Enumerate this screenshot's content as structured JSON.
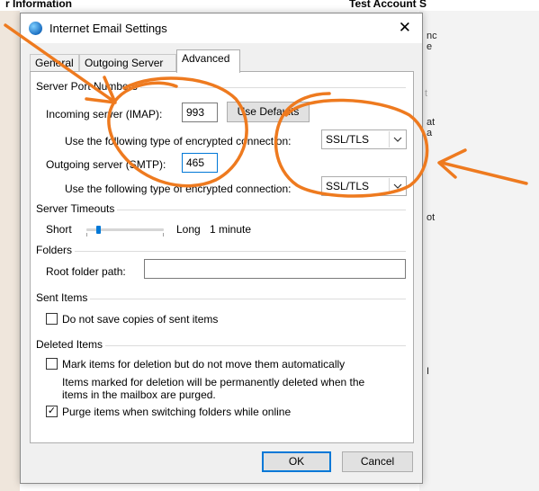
{
  "background": {
    "left_title": "r Information",
    "right_title": "Test Account S",
    "right_fragments": [
      "nc",
      "e",
      "t",
      "at",
      "a",
      "ot",
      "I"
    ]
  },
  "dialog": {
    "title": "Internet Email Settings",
    "close_glyph": "✕",
    "tabs": [
      "General",
      "Outgoing Server",
      "Advanced"
    ],
    "active_tab": "Advanced"
  },
  "server_ports": {
    "group_label": "Server Port Numbers",
    "incoming_label": "Incoming server (IMAP):",
    "incoming_value": "993",
    "use_defaults_label": "Use Defaults",
    "incoming_encryption_label": "Use the following type of encrypted connection:",
    "incoming_encryption_value": "SSL/TLS",
    "outgoing_label": "Outgoing server (SMTP):",
    "outgoing_value": "465",
    "outgoing_encryption_label": "Use the following type of encrypted connection:",
    "outgoing_encryption_value": "SSL/TLS"
  },
  "timeouts": {
    "group_label": "Server Timeouts",
    "short_label": "Short",
    "long_label": "Long",
    "value_label": "1 minute",
    "slider_level": 0.15
  },
  "folders": {
    "group_label": "Folders",
    "root_label": "Root folder path:",
    "root_value": ""
  },
  "sent_items": {
    "group_label": "Sent Items",
    "no_copies_label": "Do not save copies of sent items",
    "no_copies_checked": false
  },
  "deleted_items": {
    "group_label": "Deleted Items",
    "mark_label": "Mark items for deletion but do not move them automatically",
    "mark_checked": false,
    "mark_note_line1": "Items marked for deletion will be permanently deleted when the",
    "mark_note_line2": "items in the mailbox are purged.",
    "purge_label": "Purge items when switching folders while online",
    "purge_checked": true
  },
  "footer": {
    "ok_label": "OK",
    "cancel_label": "Cancel"
  },
  "colors": {
    "annotation": "#ee7a1f",
    "focus": "#0078d7"
  }
}
